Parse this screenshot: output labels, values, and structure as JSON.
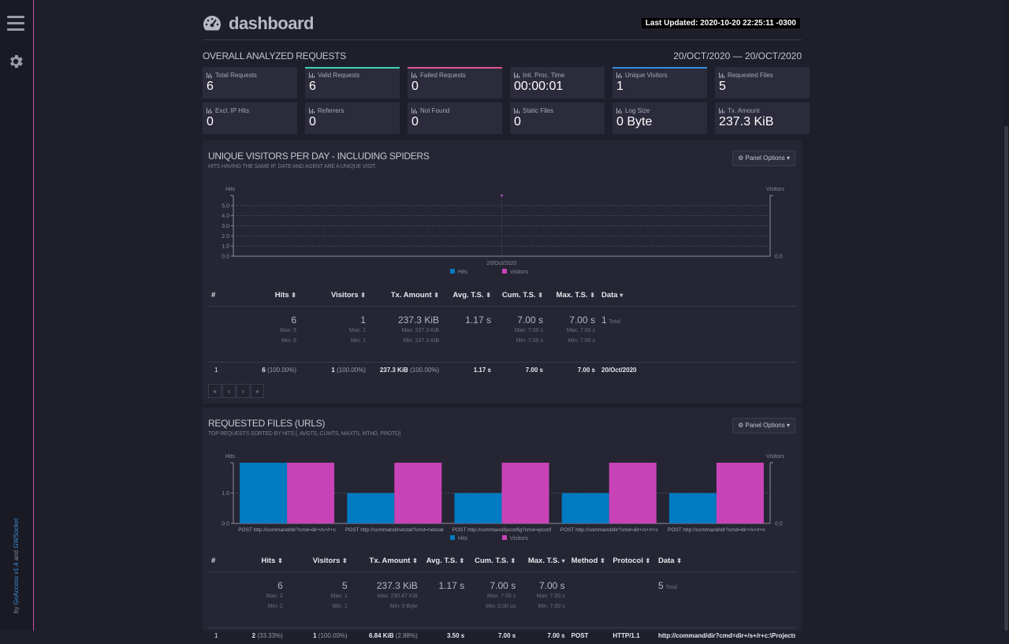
{
  "header": {
    "title": "dashboard",
    "last_updated": "Last Updated: 2020-10-20 22:25:11 -0300"
  },
  "sidebar": {
    "credits_by": "by",
    "credits_app": "GoAccess",
    "credits_version": "v1.4",
    "credits_and": "and",
    "credits_ws": "GWSocket"
  },
  "overall": {
    "title": "OVERALL ANALYZED REQUESTS",
    "date_range": "20/OCT/2020 — 20/OCT/2020",
    "cards": [
      {
        "label": "Total Requests",
        "value": "6",
        "accent": ""
      },
      {
        "label": "Valid Requests",
        "value": "6",
        "accent": "#3ed4b0"
      },
      {
        "label": "Failed Requests",
        "value": "0",
        "accent": "#e0568f"
      },
      {
        "label": "Init. Proc. Time",
        "value": "00:00:01",
        "accent": ""
      },
      {
        "label": "Unique Visitors",
        "value": "1",
        "accent": "#2d8fe0"
      },
      {
        "label": "Requested Files",
        "value": "5",
        "accent": ""
      },
      {
        "label": "Excl. IP Hits",
        "value": "0",
        "accent": ""
      },
      {
        "label": "Referrers",
        "value": "0",
        "accent": ""
      },
      {
        "label": "Not Found",
        "value": "0",
        "accent": ""
      },
      {
        "label": "Static Files",
        "value": "0",
        "accent": ""
      },
      {
        "label": "Log Size",
        "value": "0 Byte",
        "accent": ""
      },
      {
        "label": "Tx. Amount",
        "value": "237.3 KiB",
        "accent": ""
      }
    ]
  },
  "visitors_panel": {
    "title": "UNIQUE VISITORS PER DAY - INCLUDING SPIDERS",
    "subtitle": "HITS HAVING THE SAME IP, DATE AND AGENT ARE A UNIQUE VISIT.",
    "options": "Panel Options",
    "headers": {
      "num": "#",
      "hits": "Hits",
      "visitors": "Visitors",
      "tx": "Tx. Amount",
      "avgts": "Avg. T.S.",
      "cumts": "Cum. T.S.",
      "maxts": "Max. T.S.",
      "data": "Data"
    },
    "totals": {
      "hits": "6",
      "hits_max": "Max: 6",
      "hits_min": "Min: 6",
      "visitors": "1",
      "visitors_max": "Max: 1",
      "visitors_min": "Min: 1",
      "tx": "237.3 KiB",
      "tx_max": "Max: 237.3 KiB",
      "tx_min": "Min: 237.3 KiB",
      "avgts": "1.17 s",
      "cumts": "7.00 s",
      "cumts_max": "Max: 7.00 s",
      "cumts_min": "Min: 7.00 s",
      "maxts": "7.00 s",
      "maxts_max": "Max: 7.00 s",
      "maxts_min": "Min: 7.00 s",
      "data": "1",
      "data_suffix": "Total"
    },
    "rows": [
      {
        "num": "1",
        "hits": "6",
        "hits_pct": "(100.00%)",
        "visitors": "1",
        "visitors_pct": "(100.00%)",
        "tx": "237.3 KiB",
        "tx_pct": "(100.00%)",
        "avgts": "1.17 s",
        "cumts": "7.00 s",
        "maxts": "7.00 s",
        "data": "20/Oct/2020"
      }
    ],
    "pager": [
      "«",
      "‹",
      "›",
      "»"
    ]
  },
  "files_panel": {
    "title": "REQUESTED FILES (URLS)",
    "subtitle": "TOP REQUESTS SORTED BY HITS [, AVGTS, CUMTS, MAXTS, MTHD, PROTO]",
    "options": "Panel Options",
    "headers": {
      "num": "#",
      "hits": "Hits",
      "visitors": "Visitors",
      "tx": "Tx. Amount",
      "avgts": "Avg. T.S.",
      "cumts": "Cum. T.S.",
      "maxts": "Max. T.S.",
      "method": "Method",
      "protocol": "Protocol",
      "data": "Data"
    },
    "totals": {
      "hits": "6",
      "hits_max": "Max: 2",
      "hits_min": "Min: 1",
      "visitors": "5",
      "visitors_max": "Max: 1",
      "visitors_min": "Min: 1",
      "tx": "237.3 KiB",
      "tx_max": "Max: 230.47 KiB",
      "tx_min": "Min: 0 Byte",
      "avgts": "1.17 s",
      "cumts": "7.00 s",
      "cumts_max": "Max: 7.00 s",
      "cumts_min": "Min: 0.00 us",
      "maxts": "7.00 s",
      "maxts_max": "Max: 7.00 s",
      "maxts_min": "Min: 7.00 s",
      "data": "5",
      "data_suffix": "Total"
    },
    "rows": [
      {
        "num": "1",
        "hits": "2",
        "hits_pct": "(33.33%)",
        "visitors": "1",
        "visitors_pct": "(100.00%)",
        "tx": "6.84 KiB",
        "tx_pct": "(2.88%)",
        "avgts": "3.50 s",
        "cumts": "7.00 s",
        "maxts": "7.00 s",
        "method": "POST",
        "protocol": "HTTP/1.1",
        "data": "http://command/dir?cmd=dir+/s+/r+c:\\Projects"
      }
    ]
  },
  "chart_data": [
    {
      "type": "line",
      "x": [
        "20/Oct/2020"
      ],
      "series": [
        {
          "name": "Hits",
          "values": [
            6
          ]
        },
        {
          "name": "Visitors",
          "values": [
            1
          ]
        }
      ],
      "ylabel": "Hits",
      "y2label": "Visitors",
      "yticks": [
        "0.0",
        "1.0",
        "2.0",
        "3.0",
        "4.0",
        "5.0"
      ],
      "y2ticks": [
        "0.0"
      ],
      "ylim": [
        0,
        6
      ],
      "legend": "bottom",
      "colors": {
        "Hits": "#007bc2",
        "Visitors": "#c843b7"
      }
    },
    {
      "type": "bar",
      "categories": [
        "POST http://command/dir?cmd=dir+/s+/r+c",
        "POST http://command/netstat?cmd=netstat",
        "POST http://command/ipconfig?cmd=ipconf",
        "POST http://command/dir?cmd=dir+/s+/r+s",
        "POST http://command/dir?cmd=dir+/s+/r+c"
      ],
      "series": [
        {
          "name": "Hits",
          "values": [
            2,
            1,
            1,
            1,
            1
          ]
        },
        {
          "name": "Visitors",
          "values": [
            1,
            1,
            1,
            1,
            1
          ]
        }
      ],
      "ylabel": "Hits",
      "y2label": "Visitors",
      "yticks": [
        "0.0",
        "1.0"
      ],
      "y2ticks": [
        "0.0"
      ],
      "ylim": [
        0,
        2
      ],
      "y2lim": [
        0,
        1
      ],
      "legend": "bottom",
      "colors": {
        "Hits": "#007bc2",
        "Visitors": "#c843b7"
      }
    }
  ]
}
